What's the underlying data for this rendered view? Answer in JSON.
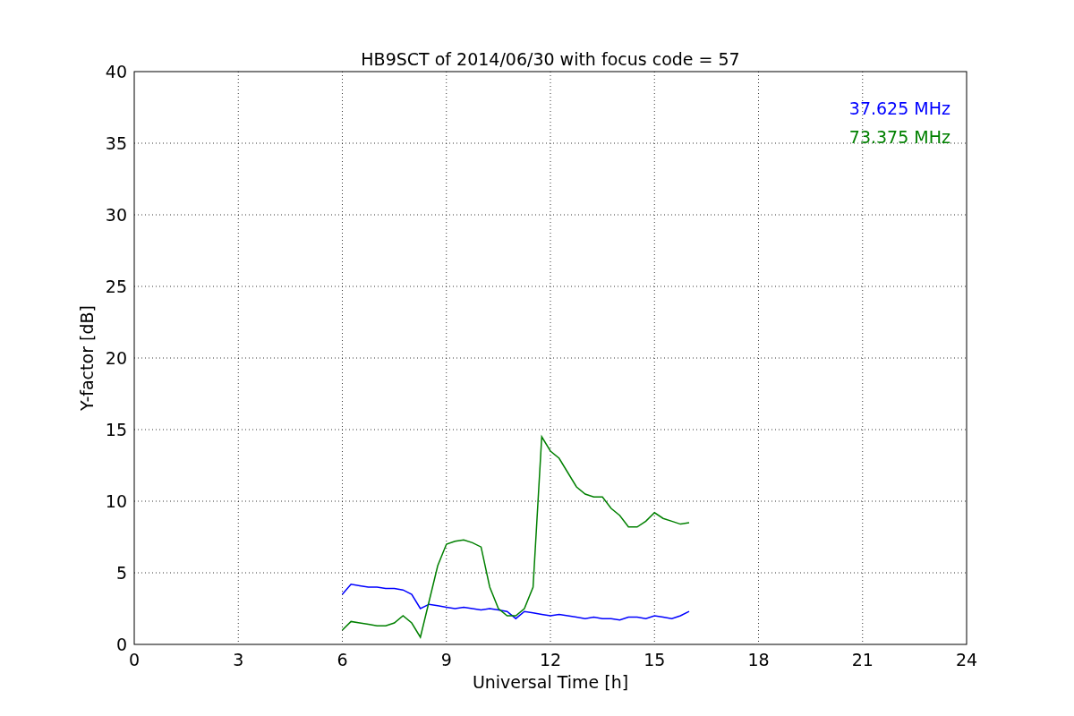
{
  "figure": {
    "chart_data": {
      "type": "line",
      "title": "HB9SCT of 2014/06/30 with focus code = 57",
      "xlabel": "Universal Time [h]",
      "ylabel": "Y-factor [dB]",
      "x": [
        6,
        6.25,
        6.5,
        6.75,
        7,
        7.25,
        7.5,
        7.75,
        8,
        8.25,
        8.5,
        8.75,
        9,
        9.25,
        9.5,
        9.75,
        10,
        10.25,
        10.5,
        10.75,
        11,
        11.25,
        11.5,
        11.75,
        12,
        12.25,
        12.5,
        12.75,
        13,
        13.25,
        13.5,
        13.75,
        14,
        14.25,
        14.5,
        14.75,
        15,
        15.25,
        15.5,
        15.75,
        16
      ],
      "series": [
        {
          "name": "37.625 MHz",
          "color": "#0000ff",
          "values": [
            3.5,
            4.2,
            4.1,
            4.0,
            4.0,
            3.9,
            3.9,
            3.8,
            3.5,
            2.5,
            2.8,
            2.7,
            2.6,
            2.5,
            2.6,
            2.5,
            2.4,
            2.5,
            2.4,
            2.3,
            1.8,
            2.3,
            2.2,
            2.1,
            2.0,
            2.1,
            2.0,
            1.9,
            1.8,
            1.9,
            1.8,
            1.8,
            1.7,
            1.9,
            1.9,
            1.8,
            2.0,
            1.9,
            1.8,
            2.0,
            2.3
          ]
        },
        {
          "name": "73.375 MHz",
          "color": "#008000",
          "values": [
            1.0,
            1.6,
            1.5,
            1.4,
            1.3,
            1.3,
            1.5,
            2.0,
            1.5,
            0.5,
            3.0,
            5.5,
            7.0,
            7.2,
            7.3,
            7.1,
            6.8,
            4.0,
            2.5,
            2.0,
            2.0,
            2.5,
            4.0,
            14.5,
            13.5,
            13.0,
            12.0,
            11.0,
            10.5,
            10.3,
            10.3,
            9.5,
            9.0,
            8.2,
            8.2,
            8.6,
            9.2,
            8.8,
            8.6,
            8.4,
            8.5
          ]
        }
      ],
      "xlim": [
        0,
        24
      ],
      "ylim": [
        0,
        40
      ],
      "xticks": [
        0,
        3,
        6,
        9,
        12,
        15,
        18,
        21,
        24
      ],
      "yticks": [
        0,
        5,
        10,
        15,
        20,
        25,
        30,
        35,
        40
      ],
      "grid": true
    }
  }
}
